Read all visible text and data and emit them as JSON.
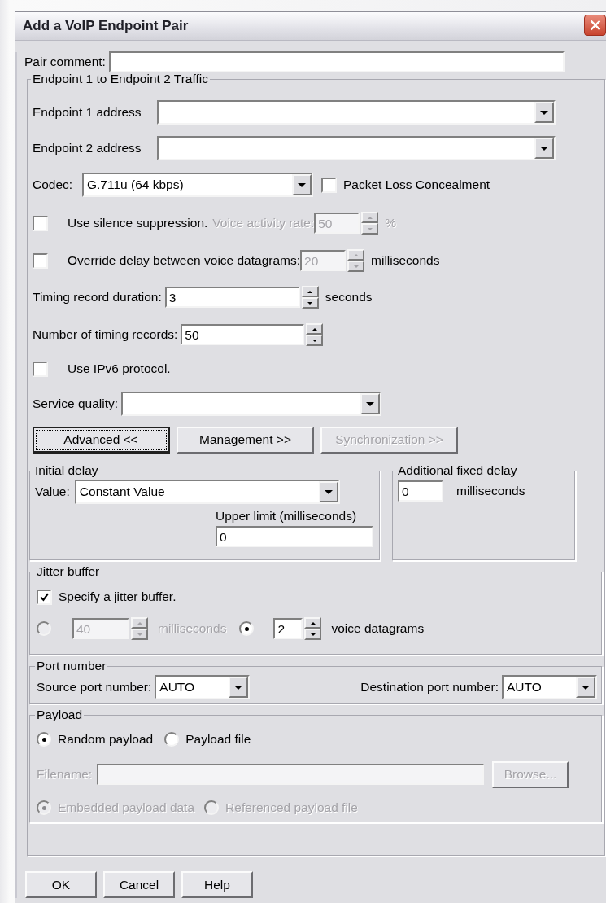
{
  "window": {
    "title": "Add a VoIP Endpoint Pair"
  },
  "pair_comment": {
    "label": "Pair comment:"
  },
  "traffic": {
    "legend": "Endpoint 1 to Endpoint 2 Traffic",
    "endpoint_1": {
      "label": "Endpoint 1 address"
    },
    "endpoint_2": {
      "label": "Endpoint 2 address"
    },
    "codec": {
      "label": "Codec:",
      "value": "G.711u (64 kbps)"
    },
    "packet_loss_concealment": {
      "label": "Packet Loss Concealment",
      "checked": false
    },
    "silence_suppression": {
      "label": "Use silence suppression.",
      "checked": false
    },
    "voice_activity_rate": {
      "label": "Voice activity rate:",
      "value": "50",
      "unit": "%",
      "disabled": true
    },
    "override_delay": {
      "label": "Override delay between voice datagrams:",
      "checked": false
    },
    "datagram_delay": {
      "value": "20",
      "unit": "milliseconds",
      "disabled": true
    },
    "timing_record_duration": {
      "label": "Timing record duration:",
      "value": "3",
      "unit": "seconds"
    },
    "number_of_timing_records": {
      "label": "Number of timing records:",
      "value": "50"
    },
    "ipv6": {
      "label": "Use IPv6 protocol.",
      "checked": false
    },
    "service_quality": {
      "label": "Service quality:"
    },
    "toggle_buttons": [
      {
        "label": "Advanced <<",
        "focused": true,
        "disabled": false
      },
      {
        "label": "Management >>",
        "focused": false,
        "disabled": false
      },
      {
        "label": "Synchronization >>",
        "focused": false,
        "disabled": true
      }
    ],
    "initial_delay": {
      "legend": "Initial delay",
      "value_label": "Value:",
      "value": "Constant Value",
      "upper_limit_label": "Upper limit (milliseconds)",
      "upper_limit": "0"
    },
    "additional_fixed_delay": {
      "legend": "Additional fixed delay",
      "value": "0",
      "unit": "milliseconds"
    },
    "jitter_buffer": {
      "legend": "Jitter buffer",
      "specify": {
        "label": "Specify a jitter buffer.",
        "checked": true
      },
      "options": [
        {
          "value": "40",
          "unit": "milliseconds",
          "selected": false,
          "disabled": true
        },
        {
          "value": "2",
          "unit": "voice datagrams",
          "selected": true,
          "disabled": false
        }
      ]
    },
    "port_number": {
      "legend": "Port number",
      "source": {
        "label": "Source port number:",
        "value": "AUTO"
      },
      "destination": {
        "label": "Destination port number:",
        "value": "AUTO"
      }
    },
    "payload": {
      "legend": "Payload",
      "sources": [
        {
          "label": "Random payload",
          "selected": true,
          "disabled": false
        },
        {
          "label": "Payload file",
          "selected": false,
          "disabled": false
        }
      ],
      "filename": {
        "label": "Filename:",
        "disabled": true
      },
      "browse": {
        "label": "Browse...",
        "disabled": true
      },
      "storage": [
        {
          "label": "Embedded payload data",
          "selected": true,
          "disabled": true
        },
        {
          "label": "Referenced payload file",
          "selected": false,
          "disabled": true
        }
      ]
    }
  },
  "buttons": [
    {
      "label": "OK"
    },
    {
      "label": "Cancel"
    },
    {
      "label": "Help"
    }
  ]
}
